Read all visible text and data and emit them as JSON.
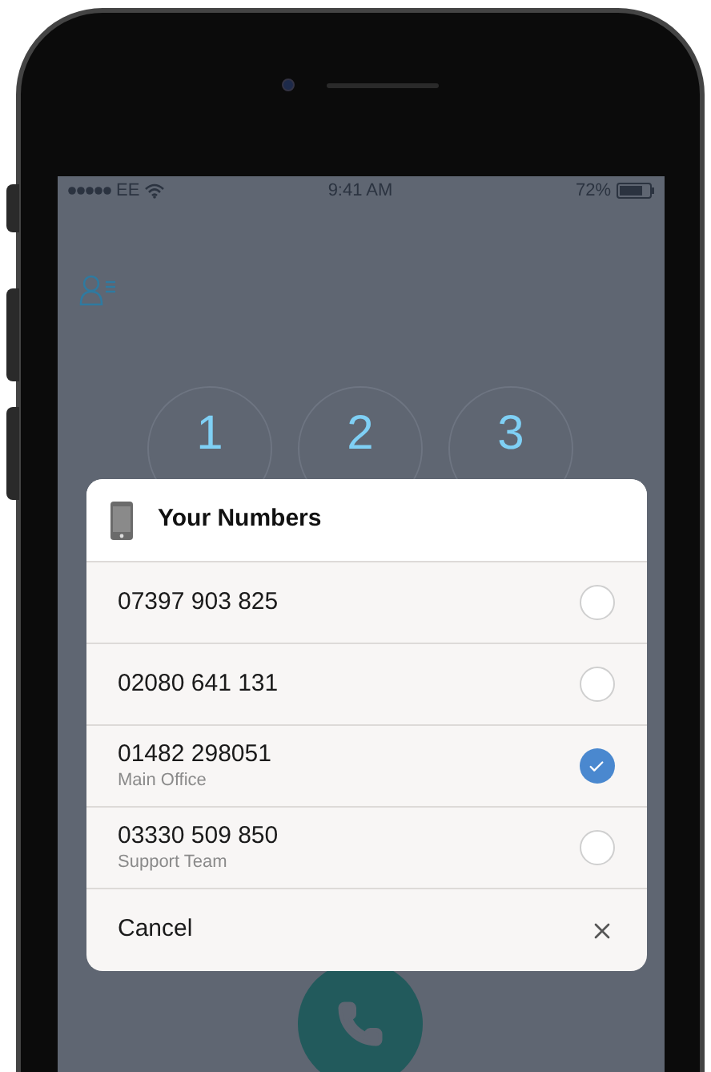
{
  "status_bar": {
    "carrier": "EE",
    "time": "9:41 AM",
    "battery": "72%"
  },
  "keypad": {
    "keys": [
      "1",
      "2",
      "3"
    ]
  },
  "dialog": {
    "title": "Your Numbers",
    "numbers": [
      {
        "number": "07397 903 825",
        "selected": false
      },
      {
        "number": "02080 641 131",
        "selected": false
      },
      {
        "number": "01482 298051",
        "label": "Main Office",
        "selected": true
      },
      {
        "number": "03330 509 850",
        "label": "Support Team",
        "selected": false
      }
    ],
    "cancel": "Cancel"
  }
}
